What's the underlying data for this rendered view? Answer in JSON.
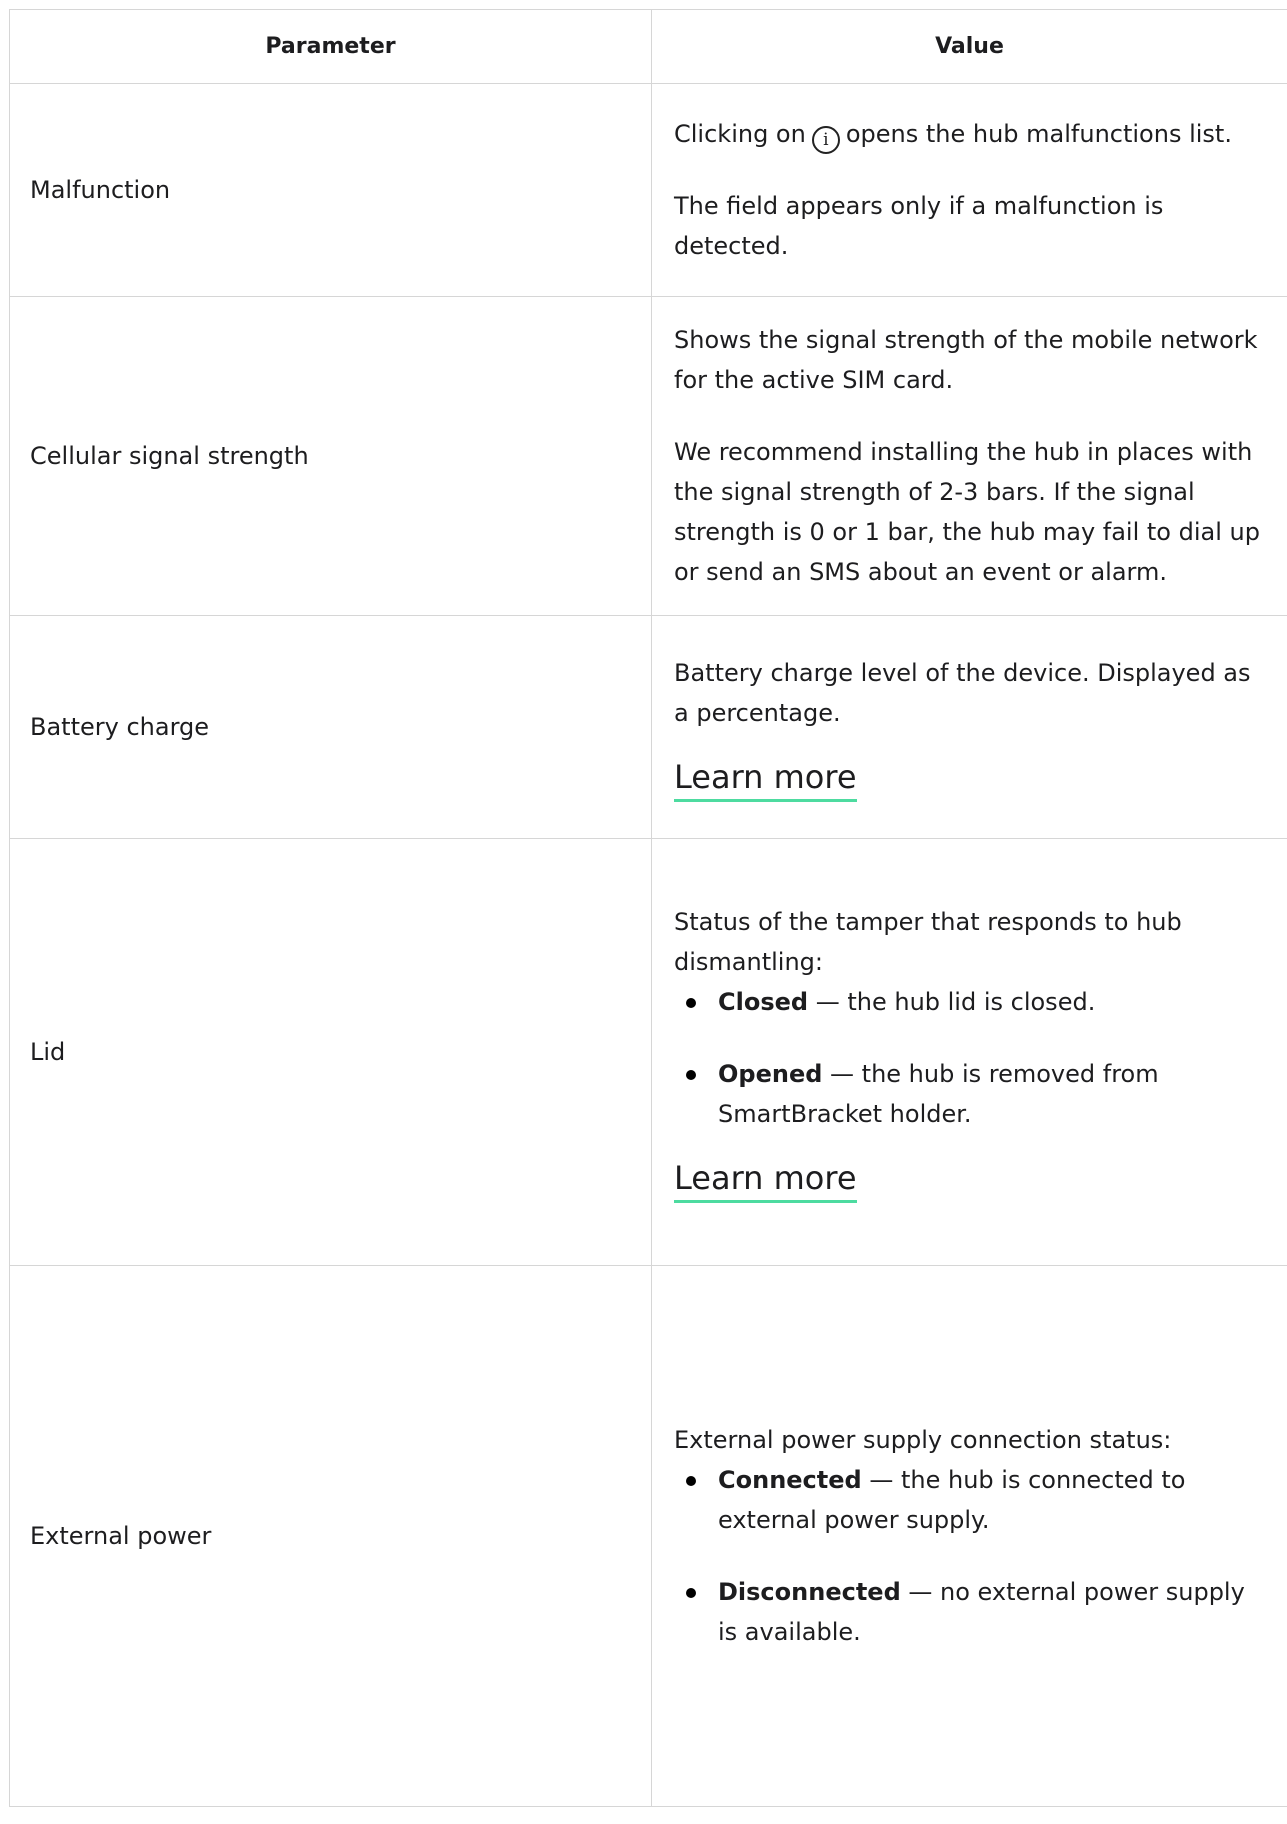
{
  "table": {
    "headers": {
      "parameter": "Parameter",
      "value": "Value"
    },
    "rows": {
      "malfunction": {
        "parameter": "Malfunction",
        "text_before_icon": "Clicking on",
        "icon_glyph": "i",
        "text_after_icon": "opens the hub malfunctions list.",
        "note": "The field appears only if a malfunction is detected."
      },
      "cellular": {
        "parameter": "Cellular signal strength",
        "p1": "Shows the signal strength of the mobile network for the active SIM card.",
        "p2": "We recommend installing the hub in places with the signal strength of 2-3 bars. If the signal strength is 0 or 1 bar, the hub may fail to dial up or send an SMS about an event or alarm."
      },
      "battery": {
        "parameter": "Battery charge",
        "p1": "Battery charge level of the device. Displayed as a percentage.",
        "link": "Learn more"
      },
      "lid": {
        "parameter": "Lid",
        "p1": "Status of the tamper that responds to hub dismantling:",
        "bullets": [
          {
            "bold": "Closed",
            "text": " — the hub lid is closed."
          },
          {
            "bold": "Opened",
            "text": " — the hub is removed from SmartBracket holder."
          }
        ],
        "link": "Learn more"
      },
      "power": {
        "parameter": "External power",
        "p1": "External power supply connection status:",
        "bullets": [
          {
            "bold": "Connected",
            "text": " — the hub is connected to external power supply."
          },
          {
            "bold": "Disconnected",
            "text": " — no external power supply is available."
          }
        ]
      }
    }
  },
  "colors": {
    "link_underline": "#4ddba0",
    "border": "#d6d6d6",
    "text": "#1d1d1f"
  },
  "icons": {
    "info": "info-circle-icon",
    "bullet": "bullet-dot-icon"
  }
}
